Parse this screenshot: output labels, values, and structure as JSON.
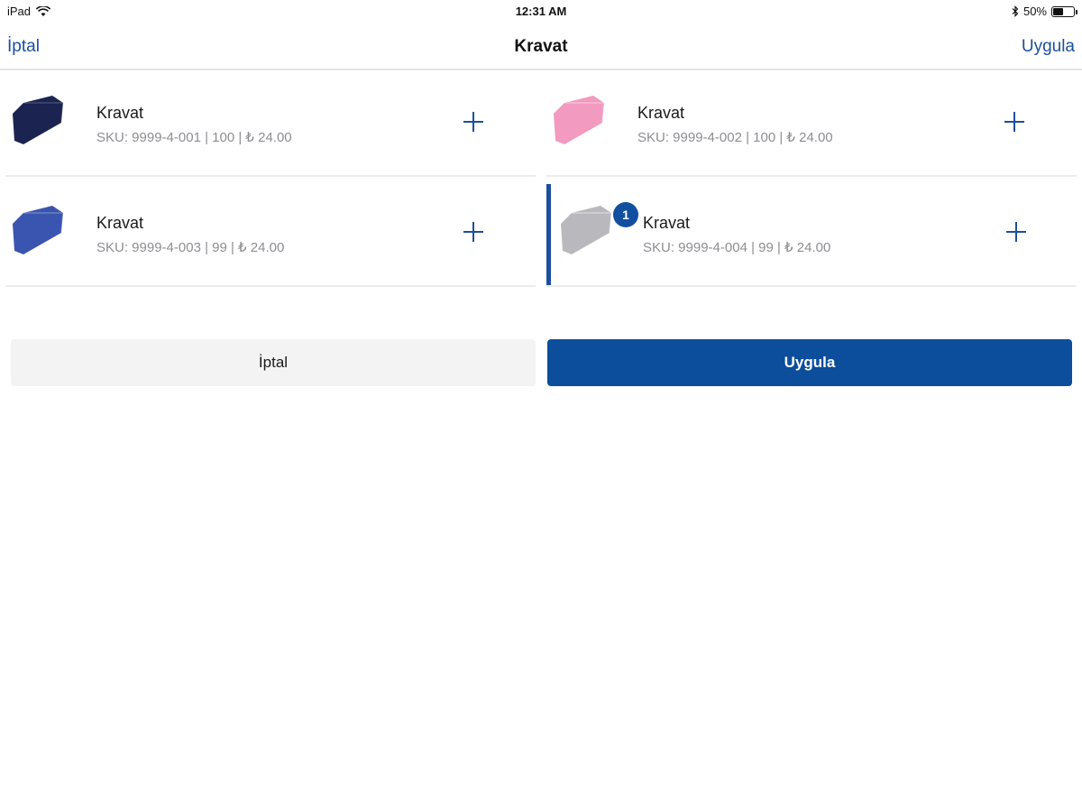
{
  "status_bar": {
    "device": "iPad",
    "time": "12:31 AM",
    "battery": "50%",
    "battery_level": 0.5
  },
  "nav": {
    "cancel_label": "İptal",
    "title": "Kravat",
    "apply_label": "Uygula"
  },
  "products": [
    {
      "name": "Kravat",
      "details": "SKU: 9999-4-001 | 100 | ₺ 24.00",
      "color": "#1b2350",
      "selected": false,
      "badge": ""
    },
    {
      "name": "Kravat",
      "details": "SKU: 9999-4-002 | 100 | ₺ 24.00",
      "color": "#f29ac0",
      "selected": false,
      "badge": ""
    },
    {
      "name": "Kravat",
      "details": "SKU: 9999-4-003 | 99 | ₺ 24.00",
      "color": "#3a55b0",
      "selected": false,
      "badge": ""
    },
    {
      "name": "Kravat",
      "details": "SKU: 9999-4-004 | 99 | ₺ 24.00",
      "color": "#b9b9bd",
      "selected": true,
      "badge": "1"
    }
  ],
  "actions": {
    "cancel_label": "İptal",
    "apply_label": "Uygula"
  },
  "colors": {
    "accent": "#1c4f9c",
    "primary_button": "#0c4d9c",
    "secondary_button": "#f3f3f3",
    "muted_text": "#8e8e93"
  }
}
